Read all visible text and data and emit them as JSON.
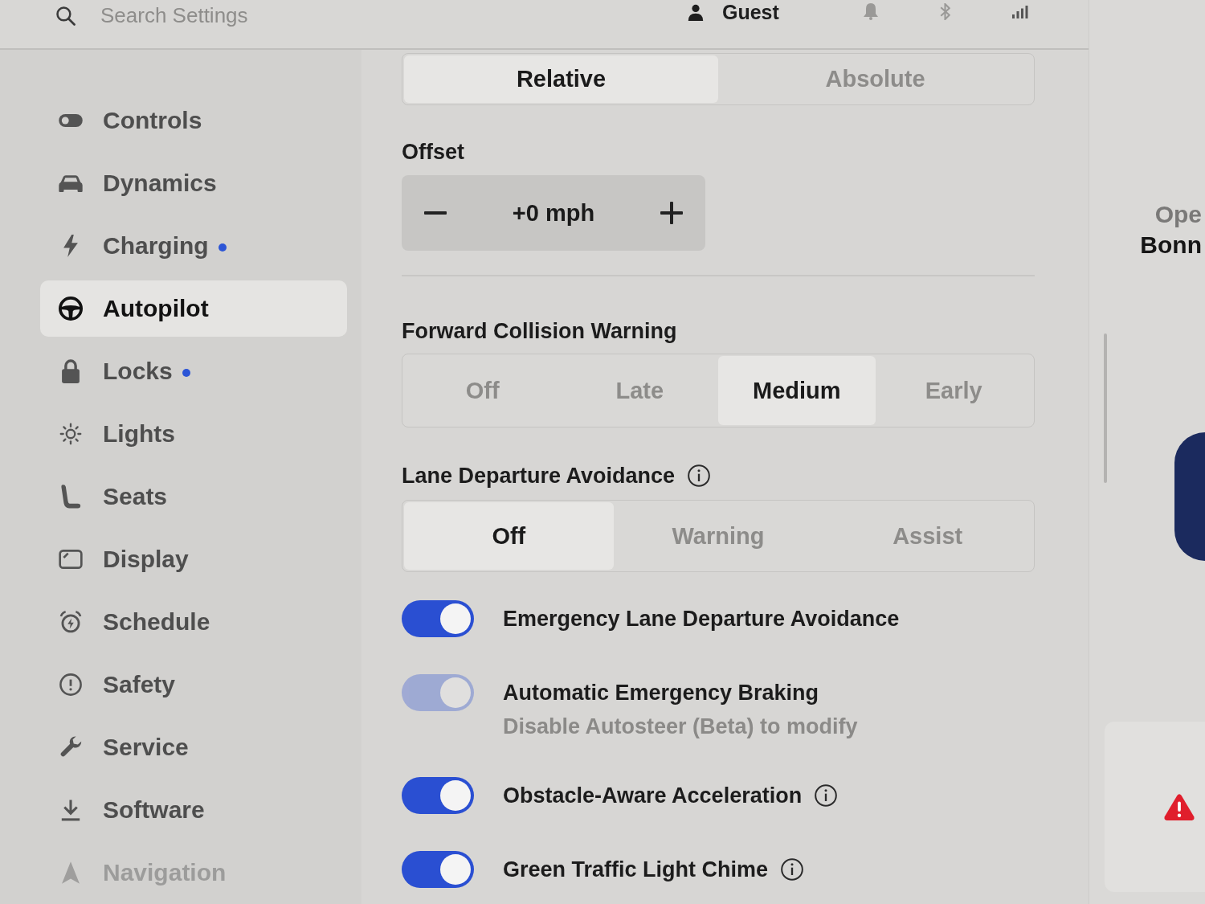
{
  "top_bar": {
    "search": {
      "placeholder": "Search Settings"
    },
    "profile": {
      "name": "Guest"
    }
  },
  "sidebar": {
    "items": [
      {
        "label": "Controls",
        "selected": false,
        "dot": false
      },
      {
        "label": "Dynamics",
        "selected": false,
        "dot": false
      },
      {
        "label": "Charging",
        "selected": false,
        "dot": true
      },
      {
        "label": "Autopilot",
        "selected": true,
        "dot": false
      },
      {
        "label": "Locks",
        "selected": false,
        "dot": true
      },
      {
        "label": "Lights",
        "selected": false,
        "dot": false
      },
      {
        "label": "Seats",
        "selected": false,
        "dot": false
      },
      {
        "label": "Display",
        "selected": false,
        "dot": false
      },
      {
        "label": "Schedule",
        "selected": false,
        "dot": false
      },
      {
        "label": "Safety",
        "selected": false,
        "dot": false
      },
      {
        "label": "Service",
        "selected": false,
        "dot": false
      },
      {
        "label": "Software",
        "selected": false,
        "dot": false
      },
      {
        "label": "Navigation",
        "selected": false,
        "dot": false
      }
    ]
  },
  "speed_limit_mode": {
    "options": [
      {
        "label": "Relative",
        "selected": true
      },
      {
        "label": "Absolute",
        "selected": false
      }
    ]
  },
  "offset": {
    "label": "Offset",
    "value": "+0 mph"
  },
  "forward_collision_warning": {
    "label": "Forward Collision Warning",
    "info": false,
    "options": [
      {
        "label": "Off",
        "selected": false
      },
      {
        "label": "Late",
        "selected": false
      },
      {
        "label": "Medium",
        "selected": true
      },
      {
        "label": "Early",
        "selected": false
      }
    ]
  },
  "lane_departure_avoidance": {
    "label": "Lane Departure Avoidance",
    "info": true,
    "options": [
      {
        "label": "Off",
        "selected": true
      },
      {
        "label": "Warning",
        "selected": false
      },
      {
        "label": "Assist",
        "selected": false
      }
    ]
  },
  "toggles": [
    {
      "label": "Emergency Lane Departure Avoidance",
      "on": true,
      "disabled": false,
      "info": false
    },
    {
      "label": "Automatic Emergency Braking",
      "hint": "Disable Autosteer (Beta) to modify",
      "on": true,
      "disabled": true,
      "info": false
    },
    {
      "label": "Obstacle-Aware Acceleration",
      "on": true,
      "disabled": false,
      "info": true
    },
    {
      "label": "Green Traffic Light Chime",
      "on": true,
      "disabled": false,
      "info": true
    }
  ],
  "side_panel": {
    "line_1": "Ope",
    "line_2": "Bonn"
  }
}
